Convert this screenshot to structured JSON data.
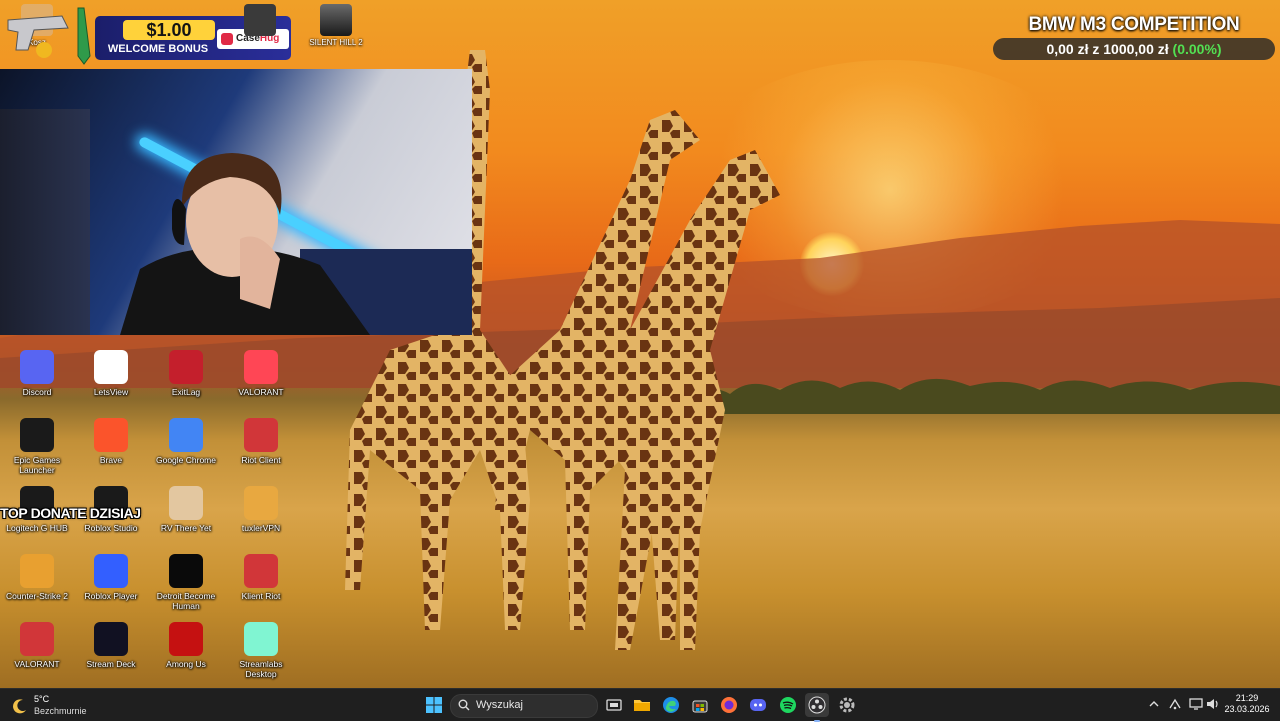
{
  "overlay": {
    "promo_price": "$1.00",
    "promo_text": "WELCOME BONUS",
    "case_brand_a": "Case",
    "case_brand_b": "Hug",
    "goal_title": "BMW M3 COMPETITION",
    "goal_amount": "0,00 zł z 1000,00 zł",
    "goal_percent": "(0.00%)",
    "goal_progress": 0,
    "top_donate": "TOP DONATE DZISIAJ"
  },
  "top_icons": [
    {
      "label": "Kosz",
      "icon": "recycle-bin-icon"
    },
    {
      "label": "SILENT HILL 2",
      "icon": "silent-hill-icon"
    }
  ],
  "desktop_icons": [
    {
      "label": "Discord",
      "icon": "discord-icon",
      "color": "#5865f2"
    },
    {
      "label": "LetsView",
      "icon": "letsview-icon",
      "color": "#ffffff"
    },
    {
      "label": "ExitLag",
      "icon": "exitlag-icon",
      "color": "#c41f2c"
    },
    {
      "label": "VALORANT",
      "icon": "valorant-icon",
      "color": "#ff4655"
    },
    {
      "label": "Epic Games Launcher",
      "icon": "epic-games-icon",
      "color": "#1a1a1a"
    },
    {
      "label": "Brave",
      "icon": "brave-icon",
      "color": "#fb542b"
    },
    {
      "label": "Google Chrome",
      "icon": "chrome-icon",
      "color": "#4285f4"
    },
    {
      "label": "Riot Client",
      "icon": "riot-client-icon",
      "color": "#d13639"
    },
    {
      "label": "Logitech G HUB",
      "icon": "logitech-icon",
      "color": "#1a1a1a"
    },
    {
      "label": "Roblox Studio",
      "icon": "roblox-studio-icon",
      "color": "#1a1a1a"
    },
    {
      "label": "RV There Yet",
      "icon": "rv-there-yet-icon",
      "color": "#e3c7a0"
    },
    {
      "label": "tuxlerVPN",
      "icon": "tuxlervpn-icon",
      "color": "#e8a840"
    },
    {
      "label": "Counter-Strike 2",
      "icon": "counter-strike-icon",
      "color": "#e8a030"
    },
    {
      "label": "Roblox Player",
      "icon": "roblox-player-icon",
      "color": "#335fff"
    },
    {
      "label": "Detroit Become Human",
      "icon": "detroit-icon",
      "color": "#0a0a0a"
    },
    {
      "label": "Klient Riot",
      "icon": "klient-riot-icon",
      "color": "#d13639"
    },
    {
      "label": "VALORANT",
      "icon": "valorant-riot-icon",
      "color": "#d13639"
    },
    {
      "label": "Stream Deck",
      "icon": "stream-deck-icon",
      "color": "#111122"
    },
    {
      "label": "Among Us",
      "icon": "among-us-icon",
      "color": "#c51111"
    },
    {
      "label": "Streamlabs Desktop",
      "icon": "streamlabs-icon",
      "color": "#80f5d2"
    }
  ],
  "taskbar": {
    "temperature": "5°C",
    "condition": "Bezchmurnie",
    "search_placeholder": "Wyszukaj",
    "time": "21:29",
    "date": "23.03.2026",
    "apps": [
      "windows-start-icon",
      "task-view-icon",
      "file-explorer-icon",
      "edge-icon",
      "store-icon",
      "firefox-icon",
      "discord-icon",
      "spotify-icon",
      "obs-icon",
      "settings-icon"
    ],
    "tray": [
      "chevron-up-icon",
      "network-icon",
      "display-icon",
      "volume-icon"
    ]
  }
}
